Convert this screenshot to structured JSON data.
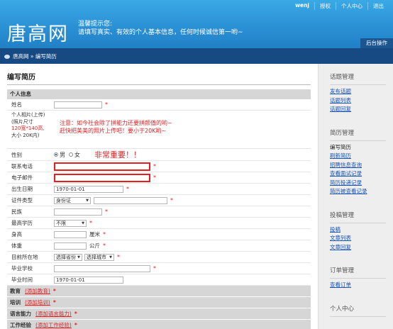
{
  "header": {
    "logo": "唐高网",
    "notice_line1": "温馨提示您:",
    "notice_line2": "请填写真实、有效的个人基本信息，任何时候诚信第一哟~",
    "toplinks": [
      "wenj",
      "授权",
      "个人中心",
      "退出"
    ],
    "backend_button": "后台操作"
  },
  "breadcrumb": "唐高网 » 编写简历",
  "page_title": "编写简历",
  "form": {
    "section_personal": "个人信息",
    "name_label": "姓名",
    "photo_label_1": "个人相片(上传)",
    "photo_label_2": "(照片尺寸",
    "photo_label_3": "120宽*140高,",
    "photo_label_4": "大小 20K内)",
    "photo_note_1": "注意：如今社会除了拼能力还要拼颜值的哟~",
    "photo_note_2": "赶快把美美的照片上传吧！要小于20K哟~",
    "gender_label": "性别",
    "gender_male": "男",
    "gender_female": "女",
    "important_note": "非常重要！！",
    "phone_label": "联系电话",
    "email_label": "电子邮件",
    "birth_label": "出生日期",
    "birth_value": "1970-01-01",
    "id_type_label": "证件类型",
    "id_type_value": "身份证",
    "ethnic_label": "民族",
    "edu_label": "最高学历",
    "edu_value": "不限",
    "height_label": "身高",
    "height_unit": "厘米",
    "weight_label": "体重",
    "weight_unit": "公斤",
    "location_label": "目前所在地",
    "province_value": "选择省份",
    "city_value": "选择城市",
    "school_label": "毕业学校",
    "grad_label": "毕业时间",
    "grad_value": "1970-01-01",
    "required_mark": "*"
  },
  "sections": [
    {
      "label": "教育",
      "link": "(添加教育)"
    },
    {
      "label": "培训",
      "link": "(添加培训)"
    },
    {
      "label": "语言能力",
      "link": "(添加语言能力)"
    },
    {
      "label": "工作经验",
      "link": "(添加工作经验)"
    }
  ],
  "sidebar": {
    "topic_title": "话题管理",
    "topic_items": [
      "发布话题",
      "话题列表",
      "话题回复"
    ],
    "resume_title": "简历管理",
    "resume_items": [
      "编写简历",
      "刷新简历",
      "招聘信息查询",
      "查看面试记录",
      "简历投递记录",
      "简历被查看记录"
    ],
    "manuscript_title": "投稿管理",
    "manuscript_items": [
      "投稿",
      "文章列表",
      "文章回复"
    ],
    "order_title": "订单管理",
    "order_items": [
      "查看订单"
    ],
    "center_title": "个人中心"
  },
  "colors": {
    "header_blue": "#2a8fd4",
    "nav_dark_blue": "#174a82",
    "required_red": "#e32020",
    "link_blue": "#1a55b8"
  }
}
